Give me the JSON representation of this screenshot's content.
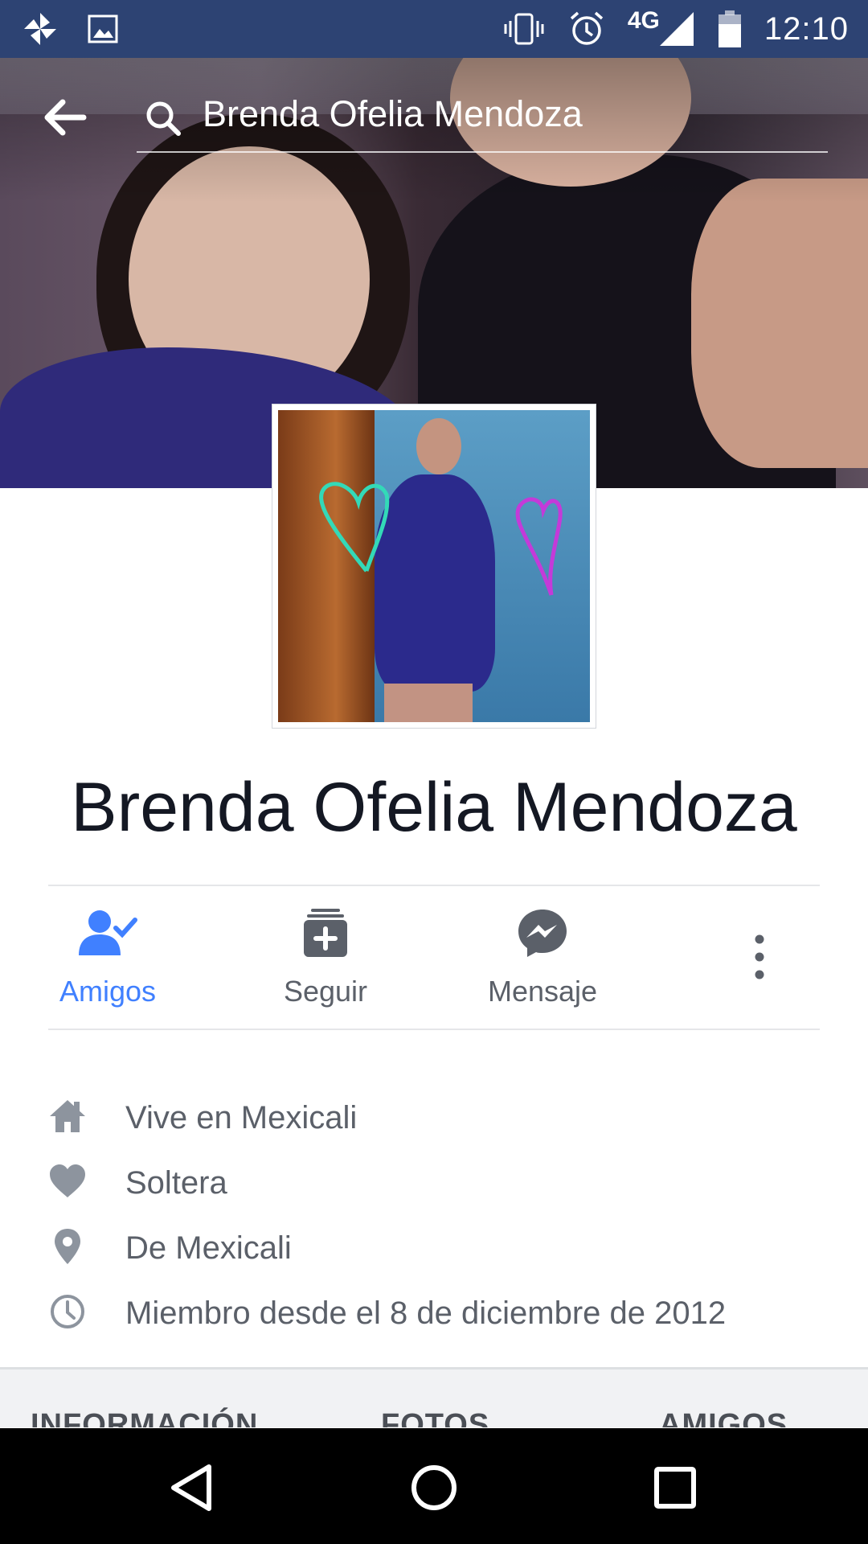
{
  "status_bar": {
    "network": "4G",
    "time": "12:10",
    "icons_left": [
      "pinwheel-icon",
      "image-icon"
    ],
    "icons_right": [
      "vibrate-icon",
      "alarm-icon",
      "signal-icon",
      "battery-icon"
    ]
  },
  "search": {
    "query": "Brenda Ofelia Mendoza"
  },
  "profile": {
    "name": "Brenda Ofelia Mendoza"
  },
  "actions": [
    {
      "label": "Amigos",
      "icon": "friends-check-icon",
      "active": true
    },
    {
      "label": "Seguir",
      "icon": "follow-icon",
      "active": false
    },
    {
      "label": "Mensaje",
      "icon": "messenger-icon",
      "active": false
    }
  ],
  "info": [
    {
      "icon": "home-icon",
      "text": "Vive en Mexicali"
    },
    {
      "icon": "heart-icon",
      "text": "Soltera"
    },
    {
      "icon": "location-pin-icon",
      "text": "De Mexicali"
    },
    {
      "icon": "clock-icon",
      "text": "Miembro desde el 8 de diciembre de 2012"
    }
  ],
  "tabs": [
    "INFORMACIÓN",
    "FOTOS",
    "AMIGOS"
  ],
  "colors": {
    "status_bar": "#2d4373",
    "accent": "#4080ff",
    "secondary_text": "#5b6069",
    "name_text": "#141823"
  }
}
